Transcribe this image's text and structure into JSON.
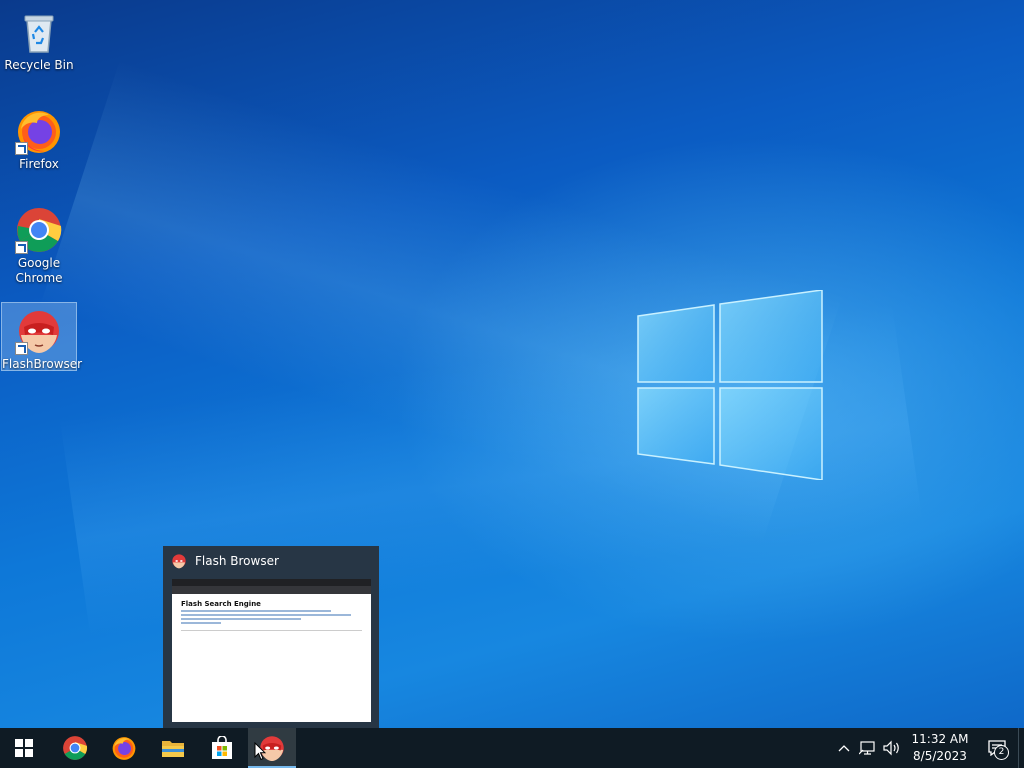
{
  "desktop": {
    "icons": [
      {
        "label": "Recycle Bin",
        "icon": "recycle-bin-icon"
      },
      {
        "label": "Firefox",
        "icon": "firefox-icon"
      },
      {
        "label": "Google Chrome",
        "icon": "chrome-icon"
      },
      {
        "label": "FlashBrowser",
        "icon": "flash-browser-icon"
      }
    ]
  },
  "preview": {
    "title": "Flash Browser",
    "heading": "Flash Search Engine"
  },
  "taskbar": {
    "apps": [
      "start-button",
      "chrome-icon",
      "firefox-icon",
      "file-explorer-icon",
      "microsoft-store-icon",
      "flash-browser-icon"
    ],
    "time": "11:32 AM",
    "date": "8/5/2023",
    "notification_count": "2"
  },
  "colors": {
    "taskbar": "#0f1b24",
    "accent": "#76b9ed"
  }
}
